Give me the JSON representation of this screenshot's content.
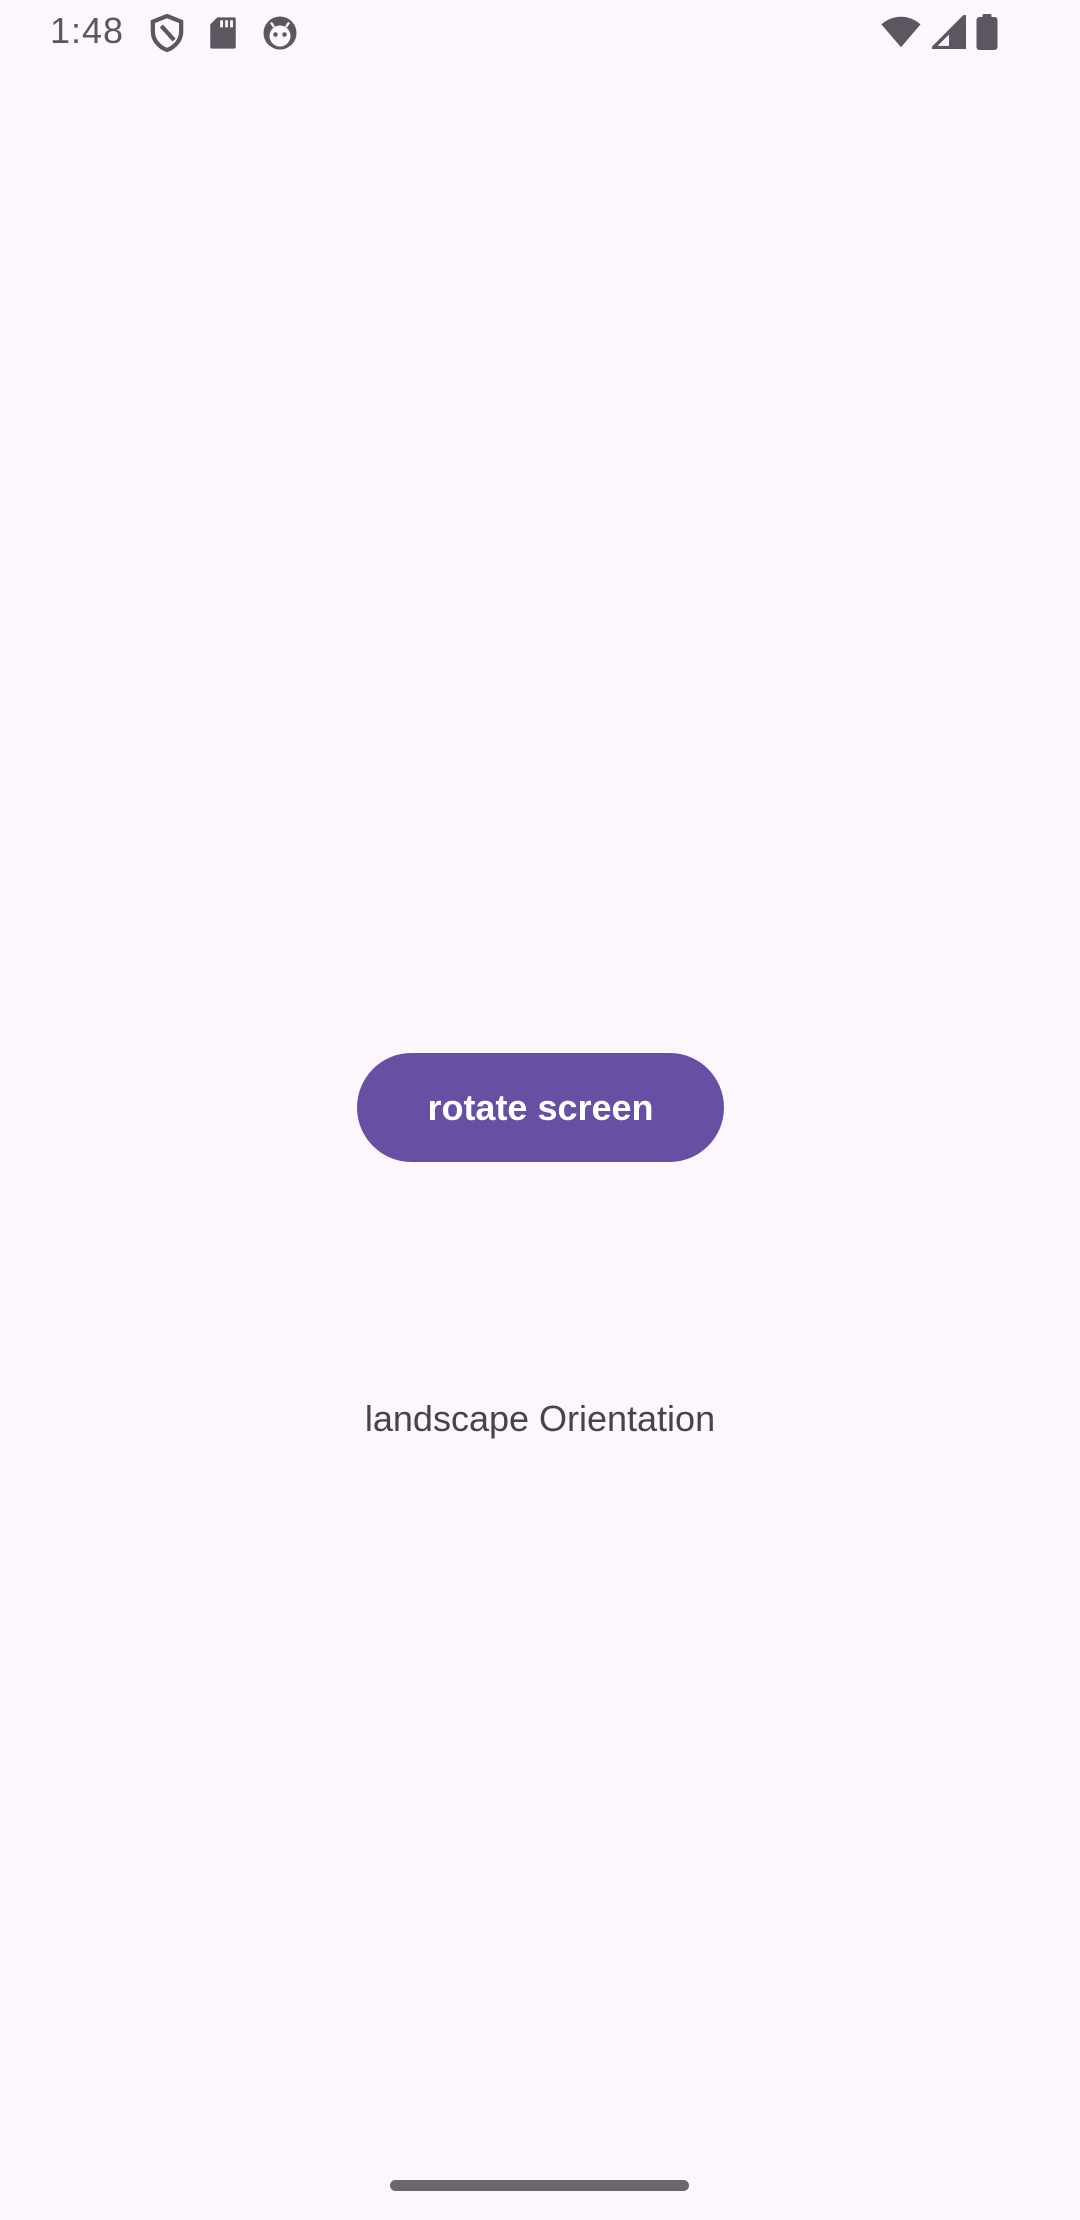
{
  "status_bar": {
    "time": "1:48",
    "left_icons": [
      "shield-icon",
      "sd-card-icon",
      "android-face-icon"
    ],
    "right_icons": [
      "wifi-icon",
      "cellular-signal-icon",
      "battery-icon"
    ],
    "icon_color": "#5b5660"
  },
  "main": {
    "rotate_button_label": "rotate screen",
    "orientation_text": "landscape Orientation"
  },
  "colors": {
    "background": "#fdf7fd",
    "button": "#674fa3",
    "button_text": "#ffffff",
    "text": "#47434b",
    "home_indicator": "#6a666e"
  }
}
